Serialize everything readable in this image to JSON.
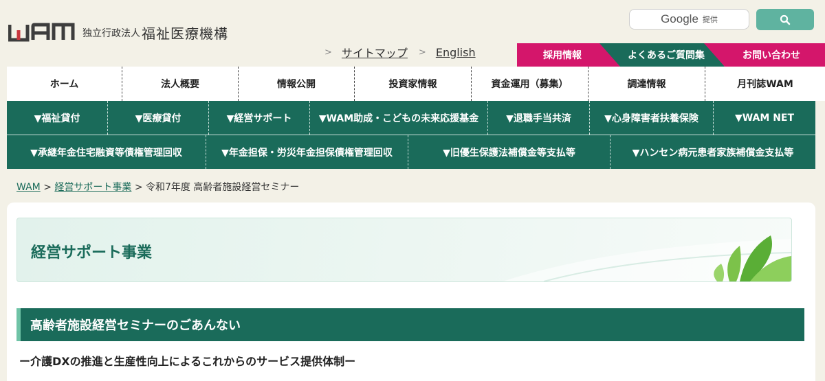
{
  "logo": {
    "mark": "WAM",
    "sub": "独立行政法人",
    "main": "福祉医療機構"
  },
  "search": {
    "brand": "Google",
    "suffix": "提供"
  },
  "toplinks": [
    {
      "label": "サイトマップ"
    },
    {
      "label": "English"
    }
  ],
  "tabs": {
    "recruit": "採用情報",
    "faq": "よくあるご質問集",
    "contact": "お問い合わせ"
  },
  "mainnav": [
    {
      "label": "ホーム"
    },
    {
      "label": "法人概要"
    },
    {
      "label": "情報公開"
    },
    {
      "label": "投資家情報"
    },
    {
      "label": "資金運用（募集）"
    },
    {
      "label": "調達情報"
    },
    {
      "label": "月刊誌WAM"
    }
  ],
  "subnav1": [
    {
      "label": "▼福祉貸付"
    },
    {
      "label": "▼医療貸付"
    },
    {
      "label": "▼経営サポート"
    },
    {
      "label": "▼WAM助成・こどもの未来応援基金"
    },
    {
      "label": "▼退職手当共済"
    },
    {
      "label": "▼心身障害者扶養保険"
    },
    {
      "label": "▼WAM NET"
    }
  ],
  "subnav2": [
    {
      "label": "▼承継年金住宅融資等債権管理回収"
    },
    {
      "label": "▼年金担保・労災年金担保債権管理回収"
    },
    {
      "label": "▼旧優生保護法補償金等支払等"
    },
    {
      "label": "▼ハンセン病元患者家族補償金支払等"
    }
  ],
  "breadcrumb": {
    "home": "WAM",
    "sep": ">",
    "section": "経営サポート事業",
    "current": "令和7年度 高齢者施設経営セミナー"
  },
  "hero": {
    "title": "経営サポート事業"
  },
  "section": {
    "heading": "高齢者施設経営セミナーのごあんない"
  },
  "lead": "ー介護DXの推進と生産性向上によるこれからのサービス提供体制ー",
  "colors": {
    "green": "#1a6b5a",
    "magenta": "#d4166b",
    "teal": "#5fb3a0",
    "bg": "#f3f1e7"
  }
}
